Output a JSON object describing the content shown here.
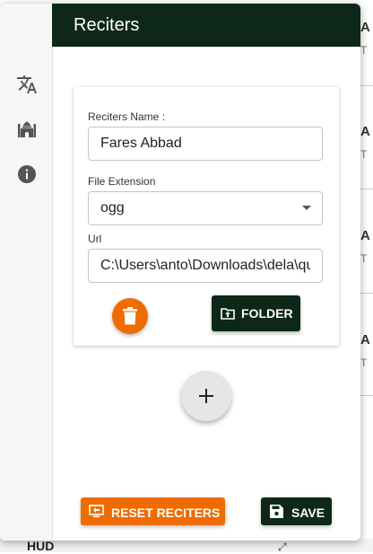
{
  "background": {
    "items": [
      {
        "letter": "A",
        "sub": "T"
      },
      {
        "letter": "A",
        "sub": "T"
      },
      {
        "letter": "A",
        "sub": "T"
      },
      {
        "letter": "A",
        "sub": "T"
      }
    ],
    "hud_label": "HUD"
  },
  "rail": {
    "icons": [
      "translate-icon",
      "mosque-icon",
      "info-icon"
    ]
  },
  "header": {
    "title": "Reciters"
  },
  "reciter": {
    "name_label": "Reciters Name :",
    "name_value": "Fares Abbad",
    "ext_label": "File Extension",
    "ext_value": "ogg",
    "url_label": "Url",
    "url_value": "C:\\Users\\anto\\Downloads\\dela\\quran"
  },
  "buttons": {
    "folder": "FOLDER",
    "reset": "RESET RECITERS",
    "save": "SAVE",
    "add": "+"
  },
  "colors": {
    "header": "#0d2818",
    "accent": "#ef6c00"
  }
}
